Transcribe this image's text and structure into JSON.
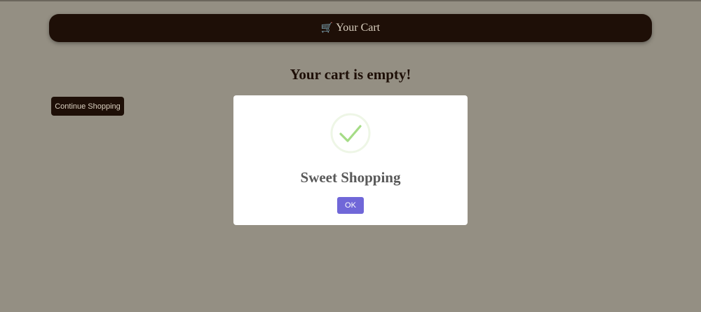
{
  "header": {
    "icon": "shopping-cart-icon",
    "cart_glyph": "🛒",
    "title": "Your Cart"
  },
  "main": {
    "empty_message": "Your cart is empty!",
    "continue_label": "Continue Shopping"
  },
  "modal": {
    "icon": "checkmark-success-icon",
    "title": "Sweet Shopping",
    "ok_label": "OK"
  },
  "colors": {
    "page_background": "#948f83",
    "dark_brown": "#1e0f07",
    "ok_button": "#7067d8",
    "success_green": "#a5dc86"
  }
}
